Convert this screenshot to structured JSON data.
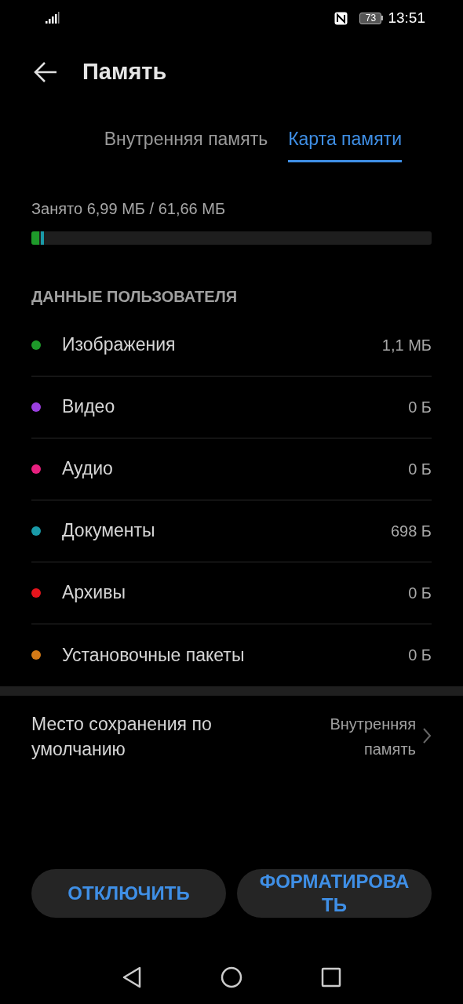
{
  "status_bar": {
    "battery": "73",
    "time": "13:51"
  },
  "header": {
    "title": "Память"
  },
  "tabs": [
    {
      "label": "Внутренняя память",
      "selected": false
    },
    {
      "label": "Карта памяти",
      "selected": true
    }
  ],
  "storage": {
    "used": "Занято 6,99 МБ / 61,66 МБ",
    "segments": [
      {
        "color": "#1e9a2a",
        "level": 0.02
      },
      {
        "color": "#1a9aa8",
        "level": 0.008
      }
    ]
  },
  "section_heading": "ДАННЫЕ ПОЛЬЗОВАТЕЛЯ",
  "categories": [
    {
      "label": "Изображения",
      "size": "1,1 МБ",
      "color": "#1e9a2a"
    },
    {
      "label": "Видео",
      "size": "0 Б",
      "color": "#9b3fe0"
    },
    {
      "label": "Аудио",
      "size": "0 Б",
      "color": "#e8207f"
    },
    {
      "label": "Документы",
      "size": "698 Б",
      "color": "#1a9aa8"
    },
    {
      "label": "Архивы",
      "size": "0 Б",
      "color": "#e5141c"
    },
    {
      "label": "Установочные пакеты",
      "size": "0 Б",
      "color": "#d57a17"
    }
  ],
  "default_location": {
    "label": "Место сохранения по умолчанию",
    "value": "Внутренняя память"
  },
  "buttons": [
    "ОТКЛЮЧИТЬ",
    "ФОРМАТИРОВАТЬ"
  ]
}
